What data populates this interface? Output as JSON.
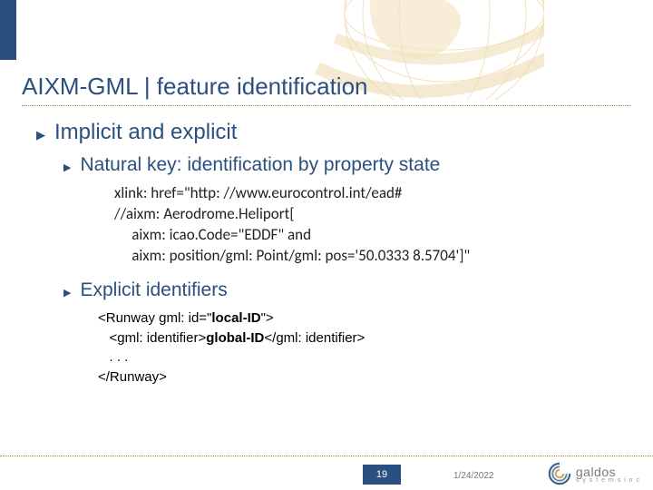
{
  "title": "AIXM-GML | feature identification",
  "bullets": {
    "main": "Implicit and explicit",
    "sub1": "Natural key: identification by property state",
    "sub2": "Explicit identifiers"
  },
  "code_natural": {
    "l1": "xlink: href=\"http: //www.eurocontrol.int/ead#",
    "l2": "//aixm: Aerodrome.Heliport[",
    "l3": "     aixm: icao.Code=\"EDDF\" and",
    "l4": "     aixm: position/gml: Point/gml: pos='50.0333 8.5704']\""
  },
  "code_explicit": {
    "l1_pre": "<Runway gml: id=\"",
    "l1_bold": "local-ID",
    "l1_post": "\">",
    "l2_pre": "   <gml: identifier>",
    "l2_bold": "global-ID",
    "l2_post": "</gml: identifier>",
    "l3": "   . . .",
    "l4": "</Runway>"
  },
  "footer": {
    "page": "19",
    "date": "1/24/2022",
    "logo": "galdos",
    "logo_tag": "s y s t e m s  i n c"
  }
}
